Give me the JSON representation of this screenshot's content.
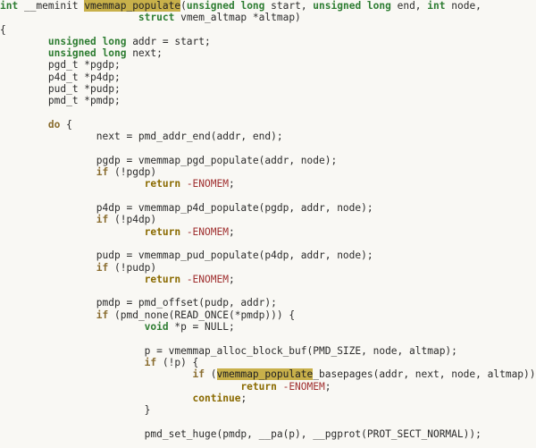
{
  "code": {
    "kw_int": "int",
    "meminit": " __meminit ",
    "fn_hl": "vmemmap_populate",
    "sig_rest": "(",
    "ul1": "unsigned long",
    "sig_start": " start, ",
    "ul2": "unsigned long",
    "sig_end": " end, ",
    "kw_int2": "int",
    "sig_node": " node,",
    "kw_struct": "struct",
    "sig_altmap": " vmem_altmap *altmap)",
    "brace_open": "{",
    "ul3": "unsigned long",
    "addr_decl": " addr = start;",
    "ul4": "unsigned long",
    "next_decl": " next;",
    "pgdp_decl": "pgd_t *pgdp;",
    "p4dp_decl": "p4d_t *p4dp;",
    "pudp_decl": "pud_t *pudp;",
    "pmdp_decl": "pmd_t *pmdp;",
    "kw_do": "do",
    "do_brace": " {",
    "next_assign": "next = pmd_addr_end(addr, end);",
    "pgdp_assign": "pgdp = vmemmap_pgd_populate(addr, node);",
    "kw_if1": "if",
    "if1_cond": " (!pgdp)",
    "kw_return1": "return",
    "ret1_val": " -ENOMEM",
    "semi": ";",
    "p4dp_assign": "p4dp = vmemmap_p4d_populate(pgdp, addr, node);",
    "kw_if2": "if",
    "if2_cond": " (!p4dp)",
    "kw_return2": "return",
    "ret2_val": " -ENOMEM",
    "pudp_assign": "pudp = vmemmap_pud_populate(p4dp, addr, node);",
    "kw_if3": "if",
    "if3_cond": " (!pudp)",
    "kw_return3": "return",
    "ret3_val": " -ENOMEM",
    "pmdp_assign": "pmdp = pmd_offset(pudp, addr);",
    "kw_if4": "if",
    "if4_cond": " (pmd_none(READ_ONCE(*pmdp))) {",
    "kw_void": "void",
    "p_null": " *p = NULL;",
    "p_assign": "p = vmemmap_alloc_block_buf(PMD_SIZE, node, altmap);",
    "kw_if5": "if",
    "if5_cond": " (!p) {",
    "kw_if6": "if",
    "if6_open": " (",
    "fn_hl2": "vmemmap_populate",
    "if6_rest": "_basepages(addr, next, node, altmap))",
    "kw_return4": "return",
    "ret4_val": " -ENOMEM",
    "kw_continue": "continue",
    "inner_close": "}",
    "pmd_set": "pmd_set_huge(pmdp, __pa(p), __pgprot(PROT_SECT_NORMAL));"
  }
}
